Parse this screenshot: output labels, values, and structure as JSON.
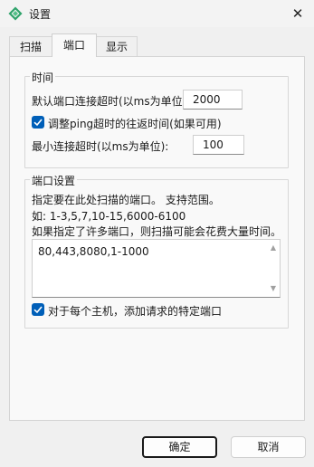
{
  "window": {
    "title": "设置",
    "close_glyph": "✕",
    "icon": "app-logo-icon"
  },
  "tabs": [
    {
      "label": "扫描",
      "active": false
    },
    {
      "label": "端口",
      "active": true
    },
    {
      "label": "显示",
      "active": false
    }
  ],
  "time_group": {
    "legend": "时间",
    "default_timeout_label": "默认端口连接超时(以ms为单位):",
    "default_timeout_value": "2000",
    "adjust_ping_label": "调整ping超时的往返时间(如果可用)",
    "adjust_ping_checked": true,
    "min_timeout_label": "最小连接超时(以ms为单位):",
    "min_timeout_value": "100"
  },
  "port_group": {
    "legend": "端口设置",
    "desc_line1": "指定要在此处扫描的端口。 支持范围。",
    "desc_line2": "如: 1-3,5,7,10-15,6000-6100",
    "desc_line3": "如果指定了许多端口，则扫描可能会花费大量时间。",
    "ports_value": "80,443,8080,1-1000",
    "add_requested_label": "对于每个主机，添加请求的特定端口",
    "add_requested_checked": true
  },
  "buttons": {
    "ok": "确定",
    "cancel": "取消"
  },
  "colors": {
    "accent": "#005fb8",
    "background": "#f0f0f0",
    "panel": "#f9f9f9"
  }
}
